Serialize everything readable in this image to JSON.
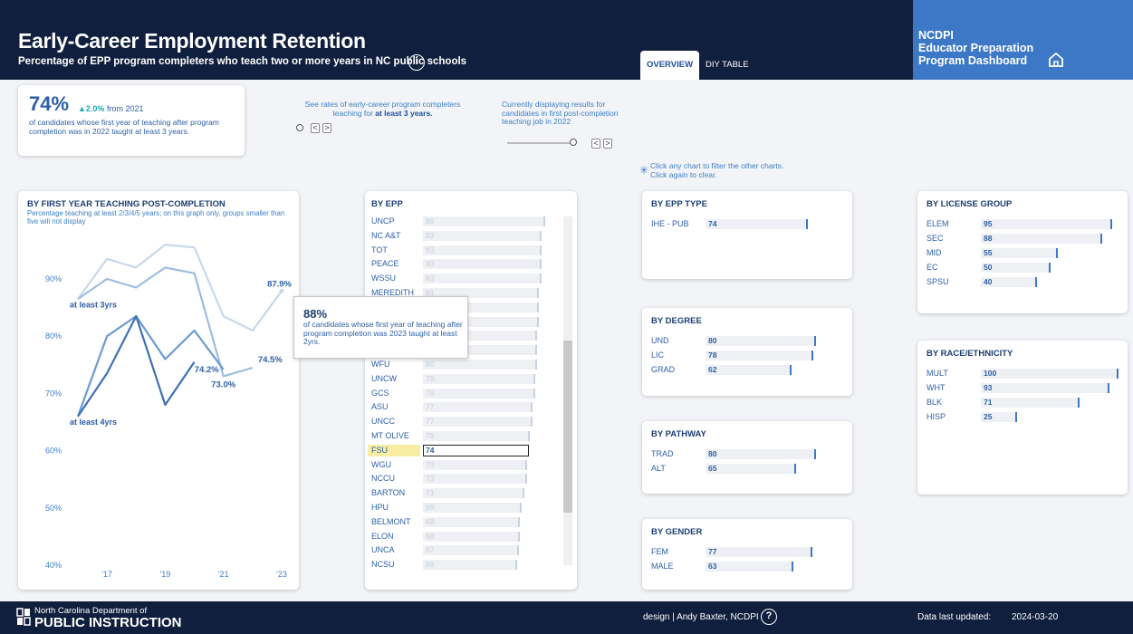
{
  "header": {
    "title": "Early-Career Employment Retention",
    "subtitle": "Percentage of EPP program completers who teach two or more years in NC public schools",
    "tabs": [
      {
        "label": "OVERVIEW",
        "active": true
      },
      {
        "label": "DIY TABLE",
        "active": false
      }
    ],
    "brand_lines": [
      "NCDPI",
      "Educator Preparation",
      "Program Dashboard"
    ]
  },
  "kpi": {
    "value": "74%",
    "delta_arrow": "▲",
    "delta_value": "2.0%",
    "delta_text": " from 2021",
    "description": "of candidates whose first year of teaching after program completion was in 2022 taught at least 3 years."
  },
  "controls": {
    "years_label_pre": "See rates of early-career program completers teaching for ",
    "years_label_bold": "at least 3 years.",
    "cohort_label": "Currently displaying results for candidates in first post-completion teaching job in 2022",
    "prev": "<",
    "next": ">"
  },
  "hint": {
    "line1": "Click any chart to filter the other charts.",
    "line2": "Click again to clear.",
    "icon": "sparkle-click-icon"
  },
  "line_card": {
    "title": "BY FIRST YEAR TEACHING POST-COMPLETION",
    "subtitle": "Percentage teaching at least 2/3/4/5 years; on this graph only, groups smaller than five will not display",
    "y_ticks": [
      "90%",
      "80%",
      "70%",
      "60%",
      "50%",
      "40%"
    ],
    "x_ticks": [
      "'17",
      "'19",
      "'21",
      "'23"
    ],
    "series_labels": [
      "at least 3yrs",
      "at least 4yrs"
    ],
    "point_labels": [
      "87.9%",
      "74.2%",
      "74.5%",
      "73.0%"
    ]
  },
  "chart_data": {
    "type": "line",
    "title": "BY FIRST YEAR TEACHING POST-COMPLETION",
    "x": [
      2016,
      2017,
      2018,
      2019,
      2020,
      2021,
      2022,
      2023
    ],
    "ylim": [
      35,
      100
    ],
    "grid": false,
    "series": [
      {
        "values": [
          86.5,
          93.5,
          92,
          96,
          95.5,
          83.5,
          81,
          87.9
        ],
        "color": "#c6d9ec"
      },
      {
        "name": "at least 3yrs",
        "values": [
          86.5,
          90,
          88.5,
          92,
          91,
          73,
          74.5,
          null
        ],
        "color": "#9cbde0"
      },
      {
        "values": [
          66,
          80,
          83.5,
          76,
          81,
          74.2,
          null,
          null
        ],
        "color": "#6b9bd1"
      },
      {
        "name": "at least 4yrs",
        "values": [
          66,
          73.5,
          83.5,
          68,
          75.5,
          null,
          null,
          null
        ],
        "color": "#3f72b5"
      }
    ]
  },
  "epp_card": {
    "title": "BY EPP",
    "rows": [
      {
        "name": "UNCP",
        "value": 86
      },
      {
        "name": "NC A&T",
        "value": 83
      },
      {
        "name": "TOT",
        "value": 83
      },
      {
        "name": "PEACE",
        "value": 83
      },
      {
        "name": "WSSU",
        "value": 83
      },
      {
        "name": "MEREDITH",
        "value": 81
      },
      {
        "name": "",
        "value": 81
      },
      {
        "name": "",
        "value": 81
      },
      {
        "name": "",
        "value": 80
      },
      {
        "name": "",
        "value": 80
      },
      {
        "name": "WFU",
        "value": 80
      },
      {
        "name": "UNCW",
        "value": 79
      },
      {
        "name": "GCS",
        "value": 79
      },
      {
        "name": "ASU",
        "value": 77
      },
      {
        "name": "UNCC",
        "value": 77
      },
      {
        "name": "MT OLIVE",
        "value": 75
      },
      {
        "name": "FSU",
        "value": 74,
        "selected": true
      },
      {
        "name": "WGU",
        "value": 73
      },
      {
        "name": "NCCU",
        "value": 73
      },
      {
        "name": "BARTON",
        "value": 71
      },
      {
        "name": "HPU",
        "value": 69
      },
      {
        "name": "BELMONT",
        "value": 68
      },
      {
        "name": "ELON",
        "value": 68
      },
      {
        "name": "UNCA",
        "value": 67
      },
      {
        "name": "NCSU",
        "value": 66
      }
    ]
  },
  "tooltip": {
    "value": "88%",
    "text": "of candidates whose first year of teaching after program completion was 2023 taught at least 2yrs."
  },
  "epp_type": {
    "title": "BY EPP TYPE",
    "rows": [
      {
        "name": "IHE - PUB",
        "value": 74
      }
    ]
  },
  "degree": {
    "title": "BY DEGREE",
    "rows": [
      {
        "name": "UND",
        "value": 80
      },
      {
        "name": "LIC",
        "value": 78
      },
      {
        "name": "GRAD",
        "value": 62
      }
    ]
  },
  "pathway": {
    "title": "BY PATHWAY",
    "rows": [
      {
        "name": "TRAD",
        "value": 80
      },
      {
        "name": "ALT",
        "value": 65
      }
    ]
  },
  "gender": {
    "title": "BY GENDER",
    "rows": [
      {
        "name": "FEM",
        "value": 77
      },
      {
        "name": "MALE",
        "value": 63
      }
    ]
  },
  "license": {
    "title": "BY LICENSE GROUP",
    "rows": [
      {
        "name": "ELEM",
        "value": 95
      },
      {
        "name": "SEC",
        "value": 88
      },
      {
        "name": "MID",
        "value": 55
      },
      {
        "name": "EC",
        "value": 50
      },
      {
        "name": "SPSU",
        "value": 40
      }
    ]
  },
  "race": {
    "title": "BY RACE/ETHNICITY",
    "rows": [
      {
        "name": "MULT",
        "value": 100
      },
      {
        "name": "WHT",
        "value": 93
      },
      {
        "name": "BLK",
        "value": 71
      },
      {
        "name": "HISP",
        "value": 25
      }
    ]
  },
  "footer": {
    "org_line1": "North Carolina Department of",
    "org_line2": "PUBLIC INSTRUCTION",
    "credit": "design | Andy Baxter, NCDPI",
    "help": "?",
    "updated_label": "Data last updated:",
    "updated_value": "2024-03-20"
  }
}
